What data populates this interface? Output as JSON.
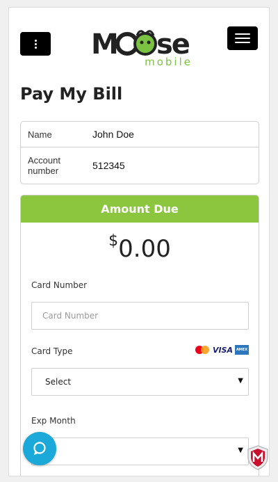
{
  "header": {
    "logo_text": "Moose",
    "logo_subtext": "mobile",
    "left_menu_icon": "vertical-dots-icon",
    "right_menu_icon": "hamburger-icon"
  },
  "page_title": "Pay My Bill",
  "account": {
    "rows": [
      {
        "label": "Name",
        "value": "John Doe"
      },
      {
        "label": "Account number",
        "value": "512345"
      }
    ]
  },
  "amount": {
    "header": "Amount Due",
    "currency": "$",
    "value": "0.00"
  },
  "form": {
    "card_number_label": "Card Number",
    "card_number_placeholder": "Card Number",
    "card_type_label": "Card Type",
    "card_type_selected": "Select",
    "card_type_icons": [
      "mastercard-icon",
      "visa-icon",
      "amex-icon"
    ],
    "visa_text": "VISA",
    "amex_text": "AMEX",
    "exp_month_label": "Exp Month",
    "exp_month_selected": ""
  },
  "widgets": {
    "chat_icon": "chat-bubble-icon",
    "security_icon": "mcafee-shield-icon"
  },
  "colors": {
    "accent_green": "#8cc63f",
    "chat_blue": "#1aa9d8",
    "header_buttons": "#000000"
  }
}
